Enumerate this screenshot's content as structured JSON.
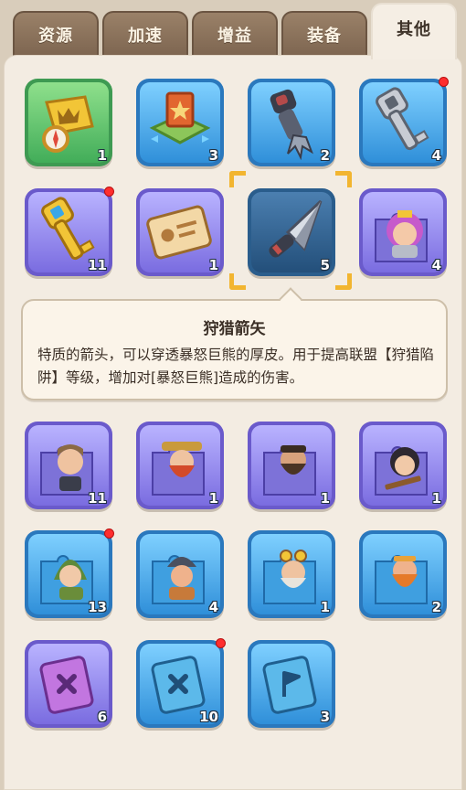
{
  "tabs": [
    {
      "label": "资源",
      "active": false
    },
    {
      "label": "加速",
      "active": false
    },
    {
      "label": "增益",
      "active": false
    },
    {
      "label": "装备",
      "active": false
    },
    {
      "label": "其他",
      "active": true
    }
  ],
  "items": [
    {
      "icon": "map-compass-icon",
      "color": "green",
      "count": "1",
      "new": false
    },
    {
      "icon": "alliance-territory-icon",
      "color": "blue",
      "count": "3",
      "new": false
    },
    {
      "icon": "grappling-claw-icon",
      "color": "blue",
      "count": "2",
      "new": false
    },
    {
      "icon": "silver-key-icon",
      "color": "blue",
      "count": "4",
      "new": true
    },
    {
      "icon": "gold-key-icon",
      "color": "purple",
      "count": "11",
      "new": true
    },
    {
      "icon": "id-card-icon",
      "color": "purple",
      "count": "1",
      "new": false
    },
    {
      "icon": "hunting-arrowhead-icon",
      "color": "selected",
      "count": "5",
      "new": false
    },
    {
      "icon": "hero-puzzle-purple-hair-icon",
      "color": "purple",
      "count": "4",
      "new": false
    },
    {
      "icon": "hero-puzzle-swordsman-icon",
      "color": "purple",
      "count": "11",
      "new": false
    },
    {
      "icon": "hero-puzzle-red-beard-icon",
      "color": "purple",
      "count": "1",
      "new": false
    },
    {
      "icon": "hero-puzzle-bearded-warrior-icon",
      "color": "purple",
      "count": "1",
      "new": false
    },
    {
      "icon": "hero-puzzle-huntress-icon",
      "color": "purple",
      "count": "1",
      "new": false
    },
    {
      "icon": "hero-puzzle-elf-archer-icon",
      "color": "blue",
      "count": "13",
      "new": true
    },
    {
      "icon": "hero-puzzle-helmet-brawler-icon",
      "color": "blue",
      "count": "4",
      "new": false
    },
    {
      "icon": "hero-puzzle-goggles-pilot-icon",
      "color": "blue",
      "count": "1",
      "new": false
    },
    {
      "icon": "hero-puzzle-orange-dwarf-icon",
      "color": "blue",
      "count": "2",
      "new": false
    },
    {
      "icon": "skill-book-purple-icon",
      "color": "purple",
      "count": "6",
      "new": false
    },
    {
      "icon": "skill-book-blue-icon",
      "color": "blue",
      "count": "10",
      "new": true
    },
    {
      "icon": "flag-book-icon",
      "color": "blue",
      "count": "3",
      "new": false
    }
  ],
  "tooltip": {
    "title": "狩猎箭矢",
    "description": "特质的箭头，可以穿透暴怒巨熊的厚皮。用于提高联盟【狩猎陷阱】等级，增加对[暴怒巨熊]造成的伤害。"
  },
  "colors": {
    "accent_selection": "#f2b530",
    "badge_red": "#ff2e2e",
    "panel_bg": "#f3ece2",
    "tab_inactive": "#8a725b"
  }
}
